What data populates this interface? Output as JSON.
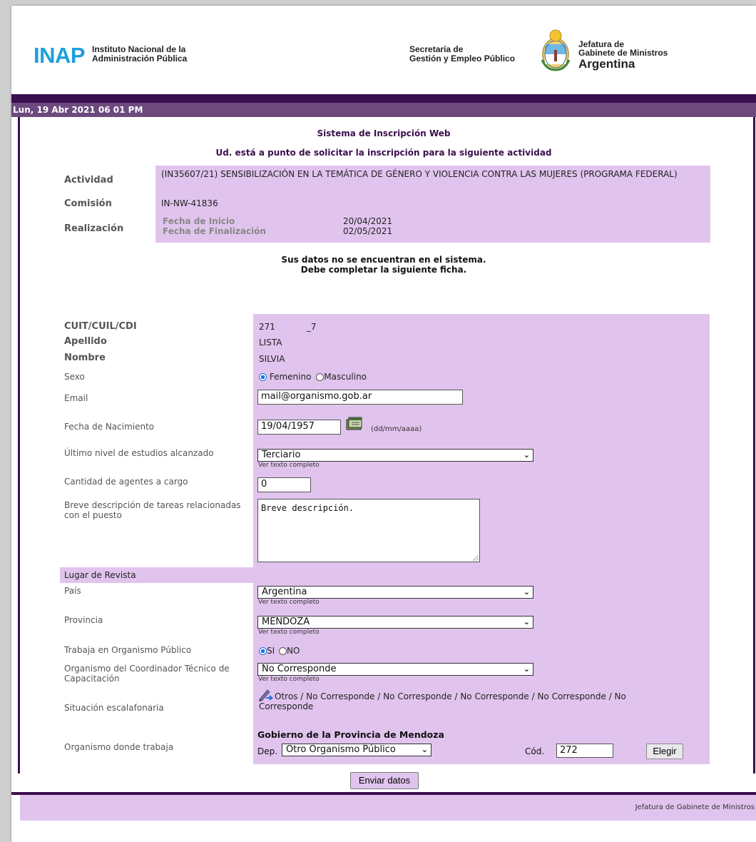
{
  "header": {
    "inap_logo": "INAP",
    "inap_line1": "Instituto Nacional de la",
    "inap_line2": "Administración Pública",
    "secretaria_line1": "Secretaría de",
    "secretaria_line2": "Gestión y Empleo Público",
    "jefatura_line1": "Jefatura de",
    "jefatura_line2": "Gabinete de Ministros",
    "jefatura_line3": "Argentina"
  },
  "datebar": {
    "date": "Lun, 19 Abr 2021 06 01 PM"
  },
  "titles": {
    "system": "Sistema de Inscripción Web",
    "subtitle": "Ud. está a punto de solicitar la inscripción para la siguiente actividad"
  },
  "activity": {
    "actividad_label": "Actividad",
    "actividad_value": "(IN35607/21) SENSIBILIZACIÓN EN LA TEMÁTICA DE GÉNERO Y VIOLENCIA CONTRA LAS MUJERES (PROGRAMA FEDERAL)",
    "comision_label": "Comisión",
    "comision_value": "IN-NW-41836",
    "realizacion_label": "Realización",
    "inicio_label": "Fecha de Inicio",
    "inicio_value": "20/04/2021",
    "fin_label": "Fecha de Finalización",
    "fin_value": "02/05/2021"
  },
  "notice": {
    "line1": "Sus datos no se encuentran en el sistema.",
    "line2": "Debe completar la siguiente ficha."
  },
  "form": {
    "cuit_label": "CUIT/CUIL/CDI",
    "cuit_value_a": "271",
    "cuit_value_b": "_7",
    "apellido_label": "Apellido",
    "apellido_value": "LISTA",
    "nombre_label": "Nombre",
    "nombre_value": "SILVIA",
    "sexo_label": "Sexo",
    "sexo_options": [
      "Femenino",
      "Masculino"
    ],
    "email_label": "Email",
    "email_value": "mail@organismo.gob.ar",
    "nacimiento_label": "Fecha de Nacimiento",
    "nacimiento_value": "19/04/1957",
    "nacimiento_hint": "(dd/mm/aaaa)",
    "estudios_label": "Último nivel de estudios alcanzado",
    "estudios_value": "Terciario",
    "ver_texto": "Ver texto completo",
    "agentes_label": "Cantidad de agentes a cargo",
    "agentes_value": "0",
    "descripcion_label": "Breve descripción de tareas relacionadas con el puesto",
    "descripcion_value": "Breve descripción.",
    "lugar_revista": "Lugar de Revista",
    "pais_label": "País",
    "pais_value": "Argentina",
    "provincia_label": "Provincia",
    "provincia_value": "MENDOZA",
    "trabaja_label": "Trabaja en Organismo Público",
    "trabaja_options": [
      "SI",
      "NO"
    ],
    "coordinador_label": "Organismo del Coordinador Técnico de Capacitación",
    "coordinador_value": "No Corresponde",
    "situacion_label": "Situación escalafonaria",
    "situacion_value": "Otros / No Corresponde / No Corresponde / No Corresponde / No Corresponde / No Corresponde",
    "organismo_label": "Organismo donde trabaja",
    "organismo_gobierno": "Gobierno de la Provincia de Mendoza",
    "dep_label": "Dep.",
    "dep_value": "Otro Organismo Público",
    "cod_label": "Cód.",
    "cod_value": "272",
    "elegir_button": "Elegir",
    "submit_button": "Enviar datos"
  },
  "footer": {
    "text": "Jefatura de Gabinete de Ministros"
  },
  "colors": {
    "inap_blue": "#1ea0dc",
    "dark_purple": "#3b0f4e",
    "datebar_purple": "#6c4a7e",
    "lilac": "#e1c4ee"
  },
  "icons": [
    "escudo-argentina-icon",
    "calendar-icon",
    "edit-pencil-icon",
    "chevron-down-icon",
    "resize-handle-icon"
  ]
}
